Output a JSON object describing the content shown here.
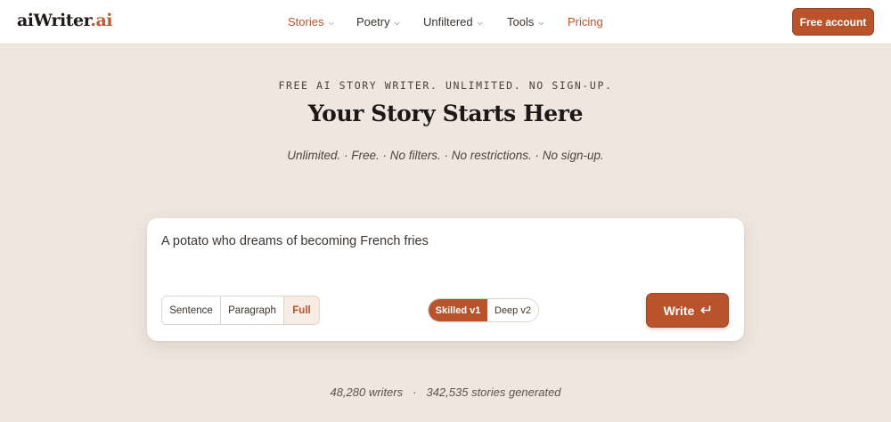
{
  "header": {
    "logo_main": "aiWriter",
    "logo_tld": ".ai",
    "nav": [
      {
        "label": "Stories",
        "has_dropdown": true,
        "active": true
      },
      {
        "label": "Poetry",
        "has_dropdown": true,
        "active": false
      },
      {
        "label": "Unfiltered",
        "has_dropdown": true,
        "active": false
      },
      {
        "label": "Tools",
        "has_dropdown": true,
        "active": false
      },
      {
        "label": "Pricing",
        "has_dropdown": false,
        "active": true
      }
    ],
    "cta_label": "Free account"
  },
  "hero": {
    "eyebrow": "FREE AI STORY WRITER. UNLIMITED. NO SIGN-UP.",
    "title": "Your Story Starts Here",
    "subtitle": "Unlimited. · Free. · No filters. · No restrictions. · No sign-up."
  },
  "prompt": {
    "value": "A potato who dreams of becoming French fries",
    "length_options": [
      "Sentence",
      "Paragraph",
      "Full"
    ],
    "length_selected": "Full",
    "model_options": [
      "Skilled v1",
      "Deep v2"
    ],
    "model_selected": "Skilled v1",
    "write_label": "Write",
    "write_icon": "enter-icon"
  },
  "stats": {
    "writers": "48,280 writers",
    "separator": "·",
    "stories": "342,535 stories generated"
  },
  "colors": {
    "accent": "#b9532c",
    "background": "#efe7df",
    "card": "#ffffff"
  }
}
